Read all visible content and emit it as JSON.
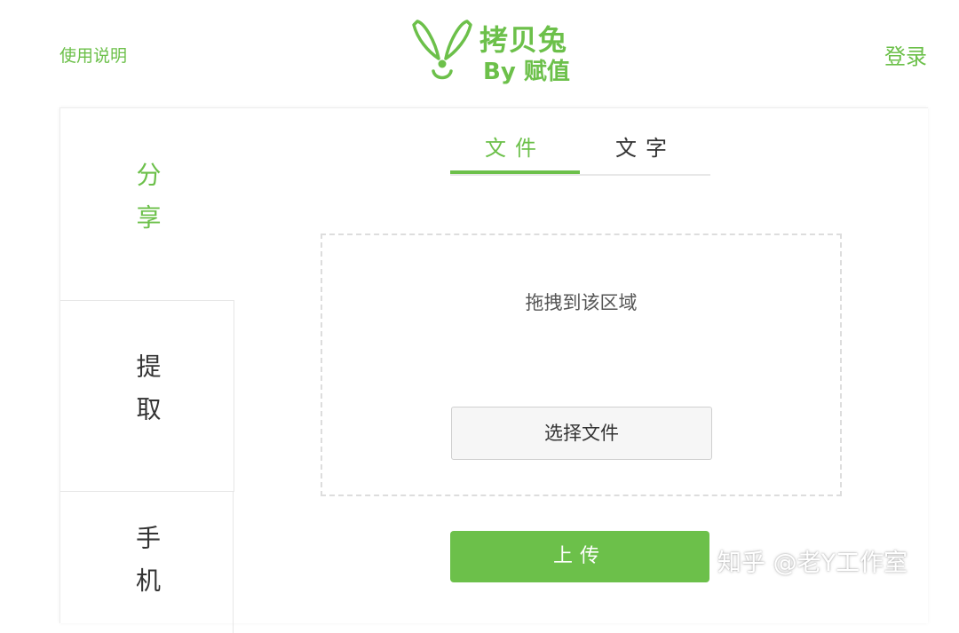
{
  "header": {
    "help_link": "使用说明",
    "login_link": "登录",
    "logo_title": "拷贝兔",
    "logo_subtitle": "By 赋值"
  },
  "sidebar": {
    "items": [
      {
        "label": "分享",
        "active": true
      },
      {
        "label": "提取",
        "active": false
      },
      {
        "label": "手机",
        "active": false
      }
    ]
  },
  "tabs": [
    {
      "label": "文件",
      "active": true
    },
    {
      "label": "文字",
      "active": false
    }
  ],
  "upload": {
    "drop_text": "拖拽到该区域",
    "choose_button": "选择文件",
    "upload_button": "上传"
  },
  "watermark": "知乎 @老Y工作室",
  "colors": {
    "accent": "#6cc04a",
    "text": "#333333",
    "border": "#e6e6e6"
  }
}
